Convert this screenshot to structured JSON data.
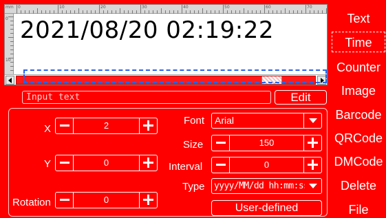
{
  "canvas": {
    "preview_text": "2021/08/20 02:19:22",
    "ruler_unit": "mm",
    "ruler_numbers": [
      "0",
      "10",
      "20",
      "30",
      "40",
      "50",
      "60",
      "70"
    ],
    "vertical_ruler_numbers": [
      "0",
      "10"
    ]
  },
  "text_input": {
    "placeholder": "Input text",
    "value": ""
  },
  "edit_button": {
    "label": "Edit"
  },
  "properties": {
    "x": {
      "label": "X",
      "value": "2"
    },
    "y": {
      "label": "Y",
      "value": "0"
    },
    "rotation": {
      "label": "Rotation",
      "value": "0"
    },
    "font": {
      "label": "Font",
      "value": "Arial"
    },
    "size": {
      "label": "Size",
      "value": "150"
    },
    "interval": {
      "label": "Interval",
      "value": "0"
    },
    "type": {
      "label": "Type",
      "value": "yyyy/MM/dd hh:mm:ss"
    },
    "user_defined": {
      "label": "User-defined"
    }
  },
  "sidebar": {
    "items": [
      {
        "label": "Text",
        "active": false
      },
      {
        "label": "Time",
        "active": true
      },
      {
        "label": "Counter",
        "active": false
      },
      {
        "label": "Image",
        "active": false
      },
      {
        "label": "Barcode",
        "active": false
      },
      {
        "label": "QRCode",
        "active": false
      },
      {
        "label": "DMCode",
        "active": false
      },
      {
        "label": "Delete",
        "active": false
      },
      {
        "label": "File",
        "active": false
      }
    ]
  },
  "colors": {
    "background": "#ff0000",
    "selection": "#2563eb",
    "canvas": "#ffffff"
  },
  "scrollbar": {
    "position": 0.88
  }
}
